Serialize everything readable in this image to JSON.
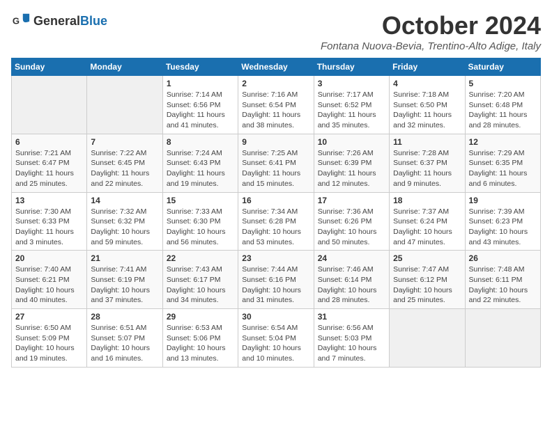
{
  "header": {
    "logo": {
      "general": "General",
      "blue": "Blue"
    },
    "title": "October 2024",
    "subtitle": "Fontana Nuova-Bevia, Trentino-Alto Adige, Italy"
  },
  "columns": [
    "Sunday",
    "Monday",
    "Tuesday",
    "Wednesday",
    "Thursday",
    "Friday",
    "Saturday"
  ],
  "weeks": [
    [
      {
        "day": "",
        "info": ""
      },
      {
        "day": "",
        "info": ""
      },
      {
        "day": "1",
        "info": "Sunrise: 7:14 AM\nSunset: 6:56 PM\nDaylight: 11 hours and 41 minutes."
      },
      {
        "day": "2",
        "info": "Sunrise: 7:16 AM\nSunset: 6:54 PM\nDaylight: 11 hours and 38 minutes."
      },
      {
        "day": "3",
        "info": "Sunrise: 7:17 AM\nSunset: 6:52 PM\nDaylight: 11 hours and 35 minutes."
      },
      {
        "day": "4",
        "info": "Sunrise: 7:18 AM\nSunset: 6:50 PM\nDaylight: 11 hours and 32 minutes."
      },
      {
        "day": "5",
        "info": "Sunrise: 7:20 AM\nSunset: 6:48 PM\nDaylight: 11 hours and 28 minutes."
      }
    ],
    [
      {
        "day": "6",
        "info": "Sunrise: 7:21 AM\nSunset: 6:47 PM\nDaylight: 11 hours and 25 minutes."
      },
      {
        "day": "7",
        "info": "Sunrise: 7:22 AM\nSunset: 6:45 PM\nDaylight: 11 hours and 22 minutes."
      },
      {
        "day": "8",
        "info": "Sunrise: 7:24 AM\nSunset: 6:43 PM\nDaylight: 11 hours and 19 minutes."
      },
      {
        "day": "9",
        "info": "Sunrise: 7:25 AM\nSunset: 6:41 PM\nDaylight: 11 hours and 15 minutes."
      },
      {
        "day": "10",
        "info": "Sunrise: 7:26 AM\nSunset: 6:39 PM\nDaylight: 11 hours and 12 minutes."
      },
      {
        "day": "11",
        "info": "Sunrise: 7:28 AM\nSunset: 6:37 PM\nDaylight: 11 hours and 9 minutes."
      },
      {
        "day": "12",
        "info": "Sunrise: 7:29 AM\nSunset: 6:35 PM\nDaylight: 11 hours and 6 minutes."
      }
    ],
    [
      {
        "day": "13",
        "info": "Sunrise: 7:30 AM\nSunset: 6:33 PM\nDaylight: 11 hours and 3 minutes."
      },
      {
        "day": "14",
        "info": "Sunrise: 7:32 AM\nSunset: 6:32 PM\nDaylight: 10 hours and 59 minutes."
      },
      {
        "day": "15",
        "info": "Sunrise: 7:33 AM\nSunset: 6:30 PM\nDaylight: 10 hours and 56 minutes."
      },
      {
        "day": "16",
        "info": "Sunrise: 7:34 AM\nSunset: 6:28 PM\nDaylight: 10 hours and 53 minutes."
      },
      {
        "day": "17",
        "info": "Sunrise: 7:36 AM\nSunset: 6:26 PM\nDaylight: 10 hours and 50 minutes."
      },
      {
        "day": "18",
        "info": "Sunrise: 7:37 AM\nSunset: 6:24 PM\nDaylight: 10 hours and 47 minutes."
      },
      {
        "day": "19",
        "info": "Sunrise: 7:39 AM\nSunset: 6:23 PM\nDaylight: 10 hours and 43 minutes."
      }
    ],
    [
      {
        "day": "20",
        "info": "Sunrise: 7:40 AM\nSunset: 6:21 PM\nDaylight: 10 hours and 40 minutes."
      },
      {
        "day": "21",
        "info": "Sunrise: 7:41 AM\nSunset: 6:19 PM\nDaylight: 10 hours and 37 minutes."
      },
      {
        "day": "22",
        "info": "Sunrise: 7:43 AM\nSunset: 6:17 PM\nDaylight: 10 hours and 34 minutes."
      },
      {
        "day": "23",
        "info": "Sunrise: 7:44 AM\nSunset: 6:16 PM\nDaylight: 10 hours and 31 minutes."
      },
      {
        "day": "24",
        "info": "Sunrise: 7:46 AM\nSunset: 6:14 PM\nDaylight: 10 hours and 28 minutes."
      },
      {
        "day": "25",
        "info": "Sunrise: 7:47 AM\nSunset: 6:12 PM\nDaylight: 10 hours and 25 minutes."
      },
      {
        "day": "26",
        "info": "Sunrise: 7:48 AM\nSunset: 6:11 PM\nDaylight: 10 hours and 22 minutes."
      }
    ],
    [
      {
        "day": "27",
        "info": "Sunrise: 6:50 AM\nSunset: 5:09 PM\nDaylight: 10 hours and 19 minutes."
      },
      {
        "day": "28",
        "info": "Sunrise: 6:51 AM\nSunset: 5:07 PM\nDaylight: 10 hours and 16 minutes."
      },
      {
        "day": "29",
        "info": "Sunrise: 6:53 AM\nSunset: 5:06 PM\nDaylight: 10 hours and 13 minutes."
      },
      {
        "day": "30",
        "info": "Sunrise: 6:54 AM\nSunset: 5:04 PM\nDaylight: 10 hours and 10 minutes."
      },
      {
        "day": "31",
        "info": "Sunrise: 6:56 AM\nSunset: 5:03 PM\nDaylight: 10 hours and 7 minutes."
      },
      {
        "day": "",
        "info": ""
      },
      {
        "day": "",
        "info": ""
      }
    ]
  ]
}
